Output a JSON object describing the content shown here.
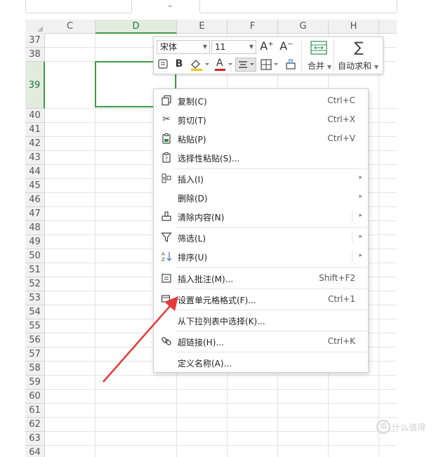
{
  "columns": [
    "C",
    "D",
    "E",
    "F",
    "G",
    "H"
  ],
  "selected_column": "D",
  "rows": [
    "37",
    "38",
    "39",
    "40",
    "41",
    "42",
    "43",
    "44",
    "45",
    "46",
    "47",
    "48",
    "49",
    "50",
    "51",
    "52",
    "53",
    "54",
    "55",
    "56",
    "57",
    "58",
    "59",
    "60",
    "61",
    "62",
    "63",
    "64"
  ],
  "selected_row": "39",
  "mini_toolbar": {
    "font_name": "宋体",
    "font_size": "11",
    "grow_font_icon": "A⁺",
    "shrink_font_icon": "A⁻",
    "merge_label": "合并",
    "autosum_label": "自动求和",
    "bold_label": "B",
    "font_color_label": "A",
    "fill_color_hex": "#f2c618",
    "font_color_hex": "#e02020"
  },
  "context_menu": {
    "items": [
      {
        "icon": "copy-icon",
        "label": "复制(C)",
        "shortcut": "Ctrl+C"
      },
      {
        "icon": "scissors-icon",
        "label": "剪切(T)",
        "shortcut": "Ctrl+X"
      },
      {
        "icon": "paste-icon",
        "label": "粘贴(P)",
        "shortcut": "Ctrl+V"
      },
      {
        "icon": "paste-special-icon",
        "label": "选择性粘贴(S)...",
        "shortcut": ""
      },
      {
        "icon": "insert-icon",
        "label": "插入(I)",
        "shortcut": ""
      },
      {
        "icon": "",
        "label": "删除(D)",
        "shortcut": ""
      },
      {
        "icon": "clear-icon",
        "label": "清除内容(N)",
        "shortcut": ""
      },
      {
        "icon": "filter-icon",
        "label": "筛选(L)",
        "shortcut": ""
      },
      {
        "icon": "sort-icon",
        "label": "排序(U)",
        "shortcut": ""
      },
      {
        "icon": "comment-icon",
        "label": "插入批注(M)...",
        "shortcut": "Shift+F2"
      },
      {
        "icon": "format-cells-icon",
        "label": "设置单元格格式(F)...",
        "shortcut": "Ctrl+1"
      },
      {
        "icon": "",
        "label": "从下拉列表中选择(K)...",
        "shortcut": ""
      },
      {
        "icon": "link-icon",
        "label": "超链接(H)...",
        "shortcut": "Ctrl+K"
      },
      {
        "icon": "",
        "label": "定义名称(A)...",
        "shortcut": ""
      }
    ]
  },
  "watermark": "什么值得"
}
